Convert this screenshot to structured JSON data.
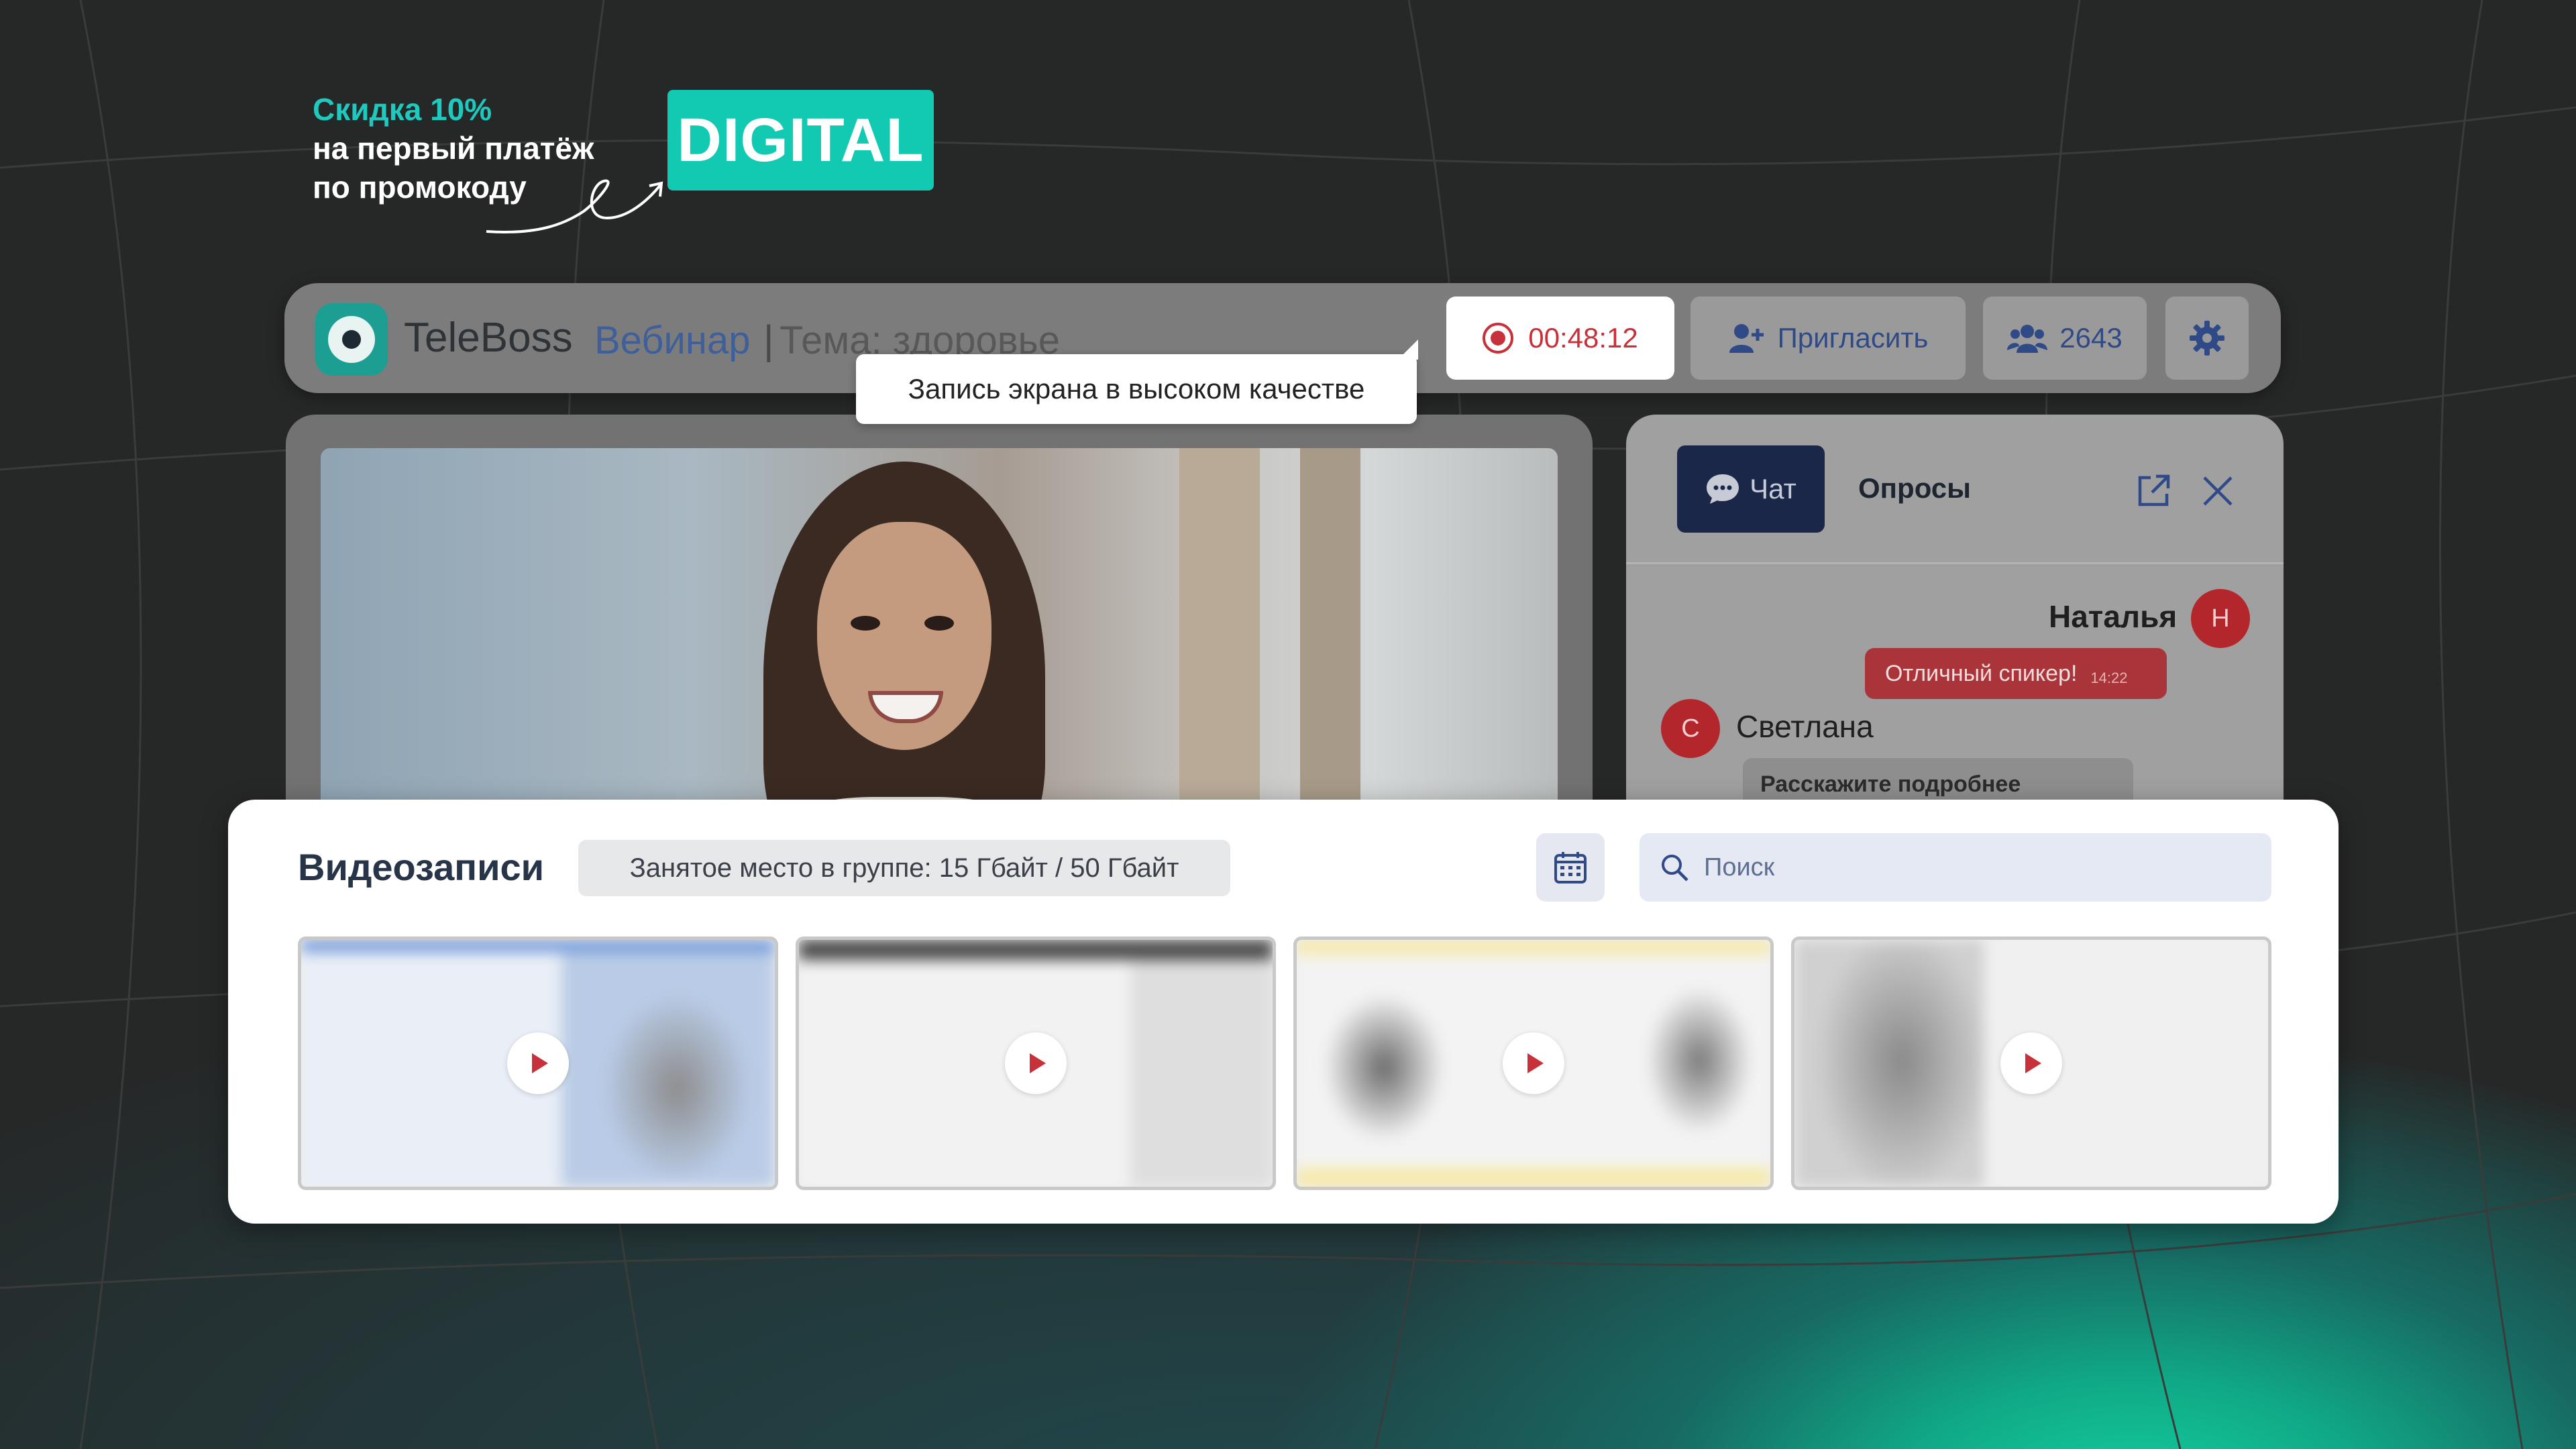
{
  "promo": {
    "discount": "Скидка 10%",
    "line1": "на первый платёж",
    "line2": "по промокоду",
    "code": "DIGITAL"
  },
  "header": {
    "brand": "TeleBoss",
    "webinar_label": "Вебинар",
    "separator": "|",
    "topic": "Тема: здоровье",
    "record_time": "00:48:12",
    "invite_label": "Пригласить",
    "participants": "2643",
    "tooltip": "Запись экрана в высоком качестве"
  },
  "chat": {
    "tabs": [
      {
        "label": "Чат",
        "active": true
      },
      {
        "label": "Опросы",
        "active": false
      }
    ],
    "messages": [
      {
        "author": "Наталья",
        "initial": "Н",
        "text": "Отличный спикер!",
        "time": "14:22"
      },
      {
        "author": "Светлана",
        "initial": "С",
        "text": "Расскажите подробнее"
      }
    ]
  },
  "recordings": {
    "title": "Видеозаписи",
    "storage": "Занятое место в группе: 15 Гбайт / 50 Гбайт",
    "search_placeholder": "Поиск"
  },
  "colors": {
    "accent_teal": "#12c9b2",
    "record_red": "#c7323a",
    "navy": "#1a2749"
  }
}
